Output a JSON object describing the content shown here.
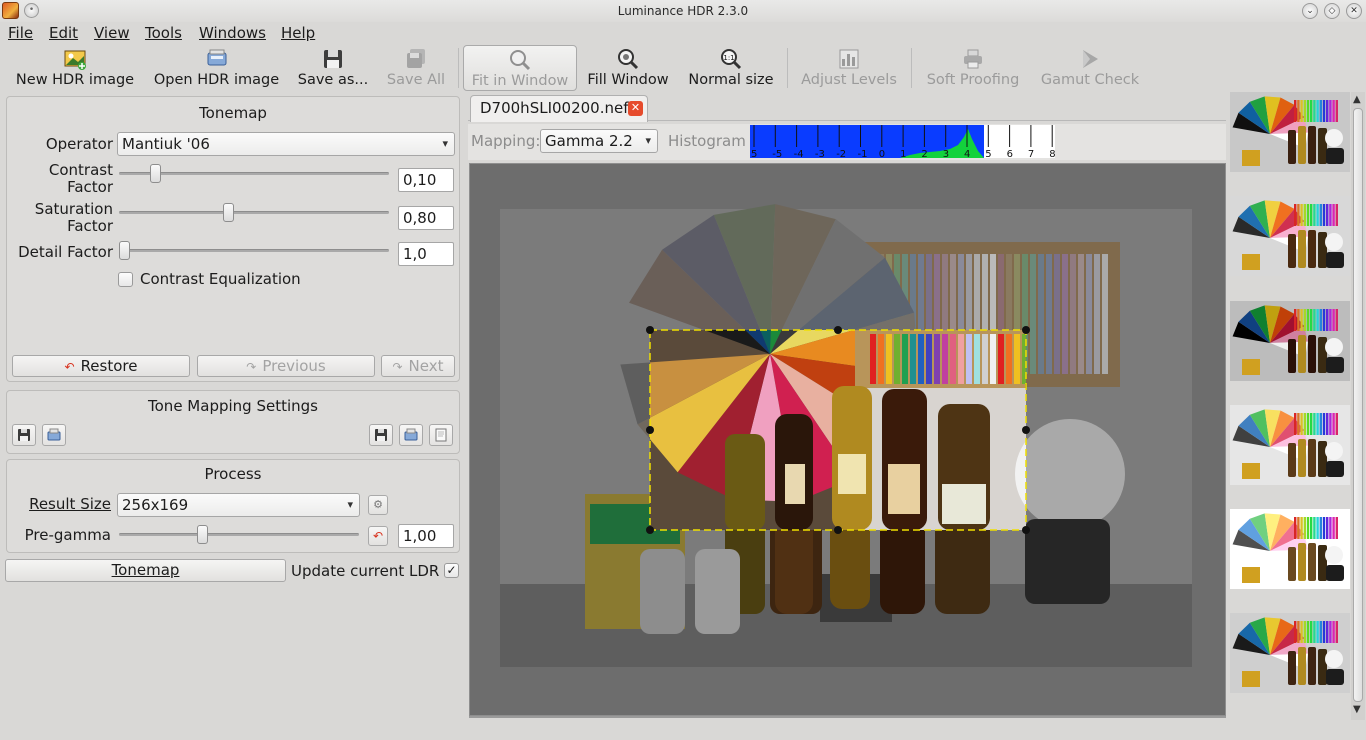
{
  "window": {
    "title": "Luminance HDR 2.3.0"
  },
  "menu": [
    "File",
    "Edit",
    "View",
    "Tools",
    "Windows",
    "Help"
  ],
  "toolbar": {
    "new_hdr": "New HDR image",
    "open_hdr": "Open HDR image",
    "save_as": "Save as...",
    "save_all": "Save All",
    "fit_in_window": "Fit in Window",
    "fill_window": "Fill Window",
    "normal_size": "Normal size",
    "adjust_levels": "Adjust Levels",
    "soft_proofing": "Soft Proofing",
    "gamut_check": "Gamut Check"
  },
  "tonemap": {
    "title": "Tonemap",
    "operator_label": "Operator",
    "operator_value": "Mantiuk '06",
    "contrast_label_1": "Contrast",
    "contrast_label_2": "Factor",
    "contrast_value": "0,10",
    "contrast_level": 0.12,
    "saturation_label_1": "Saturation",
    "saturation_label_2": "Factor",
    "saturation_value": "0,80",
    "saturation_level": 0.4,
    "detail_label": "Detail Factor",
    "detail_value": "1,0",
    "detail_level": 0.0,
    "contrast_eq_label": "Contrast Equalization",
    "contrast_eq_checked": false,
    "restore_label": "Restore",
    "previous_label": "Previous",
    "next_label": "Next"
  },
  "settings": {
    "title": "Tone Mapping Settings"
  },
  "process": {
    "title": "Process",
    "result_size_label": "Result Size",
    "result_size_value": "256x169",
    "pregamma_label": "Pre-gamma",
    "pregamma_value": "1,00",
    "pregamma_level": 0.34,
    "tonemap_button": "Tonemap",
    "update_ldr_label": "Update current LDR",
    "update_ldr_checked": true
  },
  "viewer": {
    "tab_name": "D700hSLI00200.nef",
    "mapping_label": "Mapping:",
    "mapping_value": "Gamma 2.2",
    "histogram_label": "Histogram",
    "histogram_ticks": [
      "5",
      "-5",
      "-4",
      "-3",
      "-2",
      "-1",
      "0",
      "1",
      "2",
      "3",
      "4",
      "5",
      "6",
      "7",
      "8"
    ]
  },
  "colors": {
    "window_bg": "#d9d8d6",
    "viewer_bg": "#6d6d6d",
    "selection": "#f0e000",
    "histogram_blue": "#0a3cff",
    "histogram_green": "#13d23c",
    "tab_close": "#e64b2c"
  },
  "icons": [
    "app-icon",
    "pin-icon",
    "new-hdr-icon",
    "open-hdr-icon",
    "save-as-icon",
    "save-all-icon",
    "zoom-fit-icon",
    "zoom-fill-icon",
    "zoom-normal-icon",
    "levels-icon",
    "printer-icon",
    "gamut-icon",
    "restore-icon",
    "previous-icon",
    "next-icon",
    "save-icon",
    "open-icon",
    "copy-icon",
    "info-icon",
    "reset-icon",
    "close-icon",
    "chevron-down-icon"
  ]
}
